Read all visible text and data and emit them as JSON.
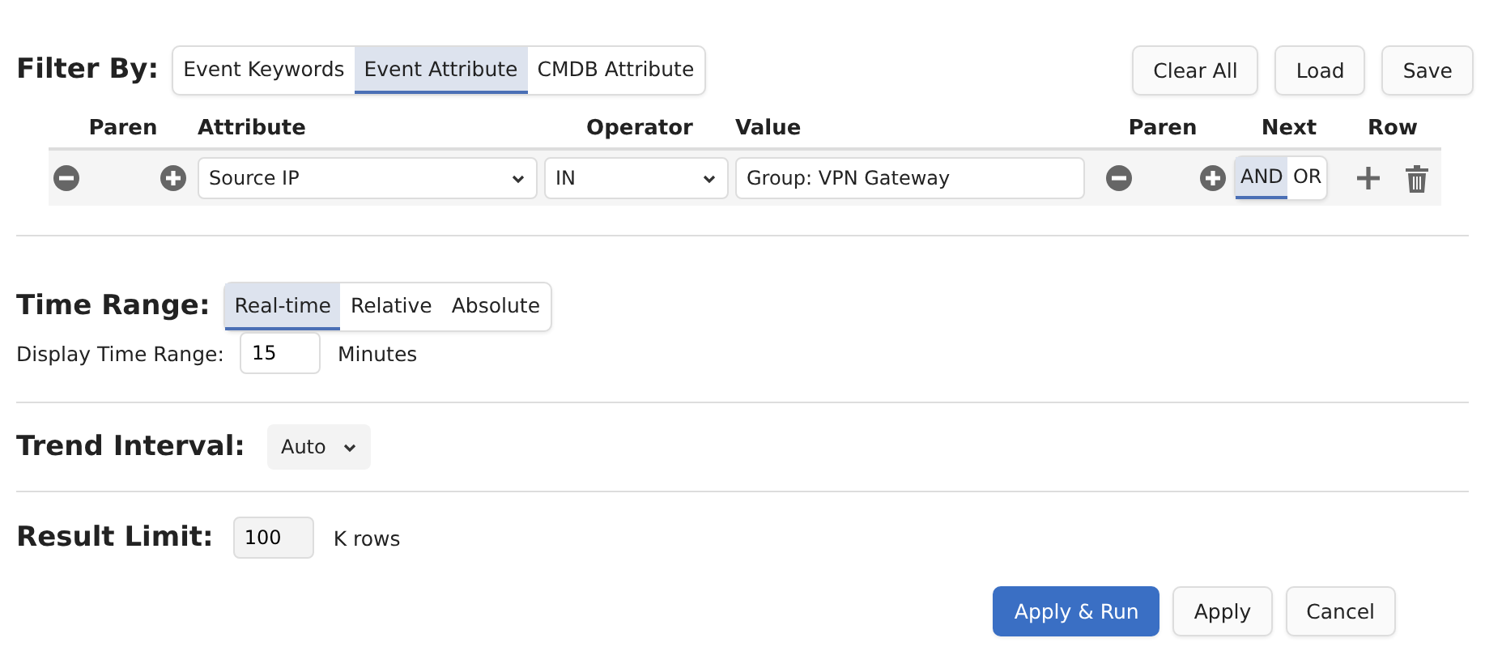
{
  "filter": {
    "label": "Filter By:",
    "tabs": [
      {
        "label": "Event Keywords",
        "selected": false
      },
      {
        "label": "Event Attribute",
        "selected": true
      },
      {
        "label": "CMDB Attribute",
        "selected": false
      }
    ],
    "actions": [
      "Clear All",
      "Load",
      "Save"
    ],
    "columns": [
      "Paren",
      "Attribute",
      "Operator",
      "Value",
      "Paren",
      "Next",
      "Row"
    ],
    "rows": [
      {
        "attribute": "Source IP",
        "operator": "IN",
        "value": "Group: VPN Gateway",
        "next": [
          {
            "label": "AND",
            "selected": true
          },
          {
            "label": "OR",
            "selected": false
          }
        ]
      }
    ]
  },
  "time_range": {
    "label": "Time Range:",
    "tabs": [
      {
        "label": "Real-time",
        "selected": true
      },
      {
        "label": "Relative",
        "selected": false
      },
      {
        "label": "Absolute",
        "selected": false
      }
    ],
    "display_label": "Display Time Range:",
    "display_value": "15",
    "unit": "Minutes"
  },
  "trend_interval": {
    "label": "Trend Interval:",
    "value": "Auto"
  },
  "result_limit": {
    "label": "Result Limit:",
    "value": "100",
    "unit": "K rows"
  },
  "buttons": [
    {
      "label": "Apply & Run",
      "kind": "primary"
    },
    {
      "label": "Apply",
      "kind": "default"
    },
    {
      "label": "Cancel",
      "kind": "default"
    }
  ]
}
